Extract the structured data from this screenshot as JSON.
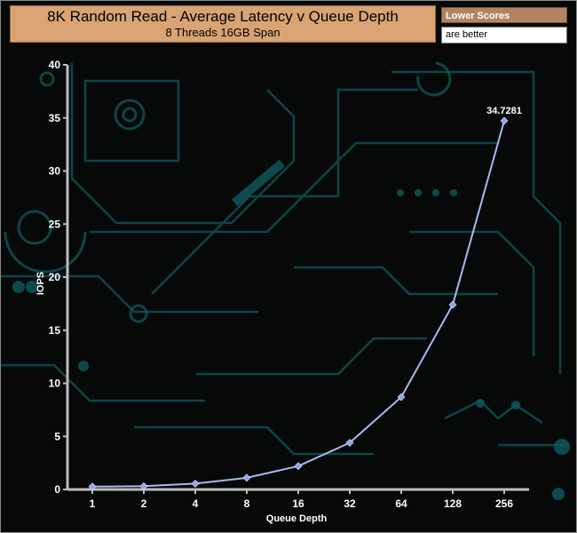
{
  "header": {
    "title": "8K Random Read - Average Latency v Queue Depth",
    "subtitle": "8 Threads 16GB Span"
  },
  "notes": {
    "line1": "Lower Scores",
    "line2": "are better"
  },
  "chart_data": {
    "type": "line",
    "title": "8K Random Read - Average Latency v Queue Depth",
    "subtitle": "8 Threads 16GB Span",
    "xlabel": "Queue Depth",
    "ylabel": "IOPS",
    "categories": [
      "1",
      "2",
      "4",
      "8",
      "16",
      "32",
      "64",
      "128",
      "256"
    ],
    "y_ticks": [
      0,
      5,
      10,
      15,
      20,
      25,
      30,
      35,
      40
    ],
    "ylim": [
      0,
      40
    ],
    "series": [
      {
        "values": [
          0.27,
          0.31,
          0.55,
          1.1,
          2.2,
          4.4,
          8.7,
          17.4,
          34.7281
        ]
      }
    ],
    "labeled_point": {
      "index": 8,
      "text": "34.7281"
    },
    "grid": false,
    "colors": {
      "line": "#a9b8ee",
      "marker": "#8fa4e8",
      "axis": "#bdbdbd"
    }
  }
}
